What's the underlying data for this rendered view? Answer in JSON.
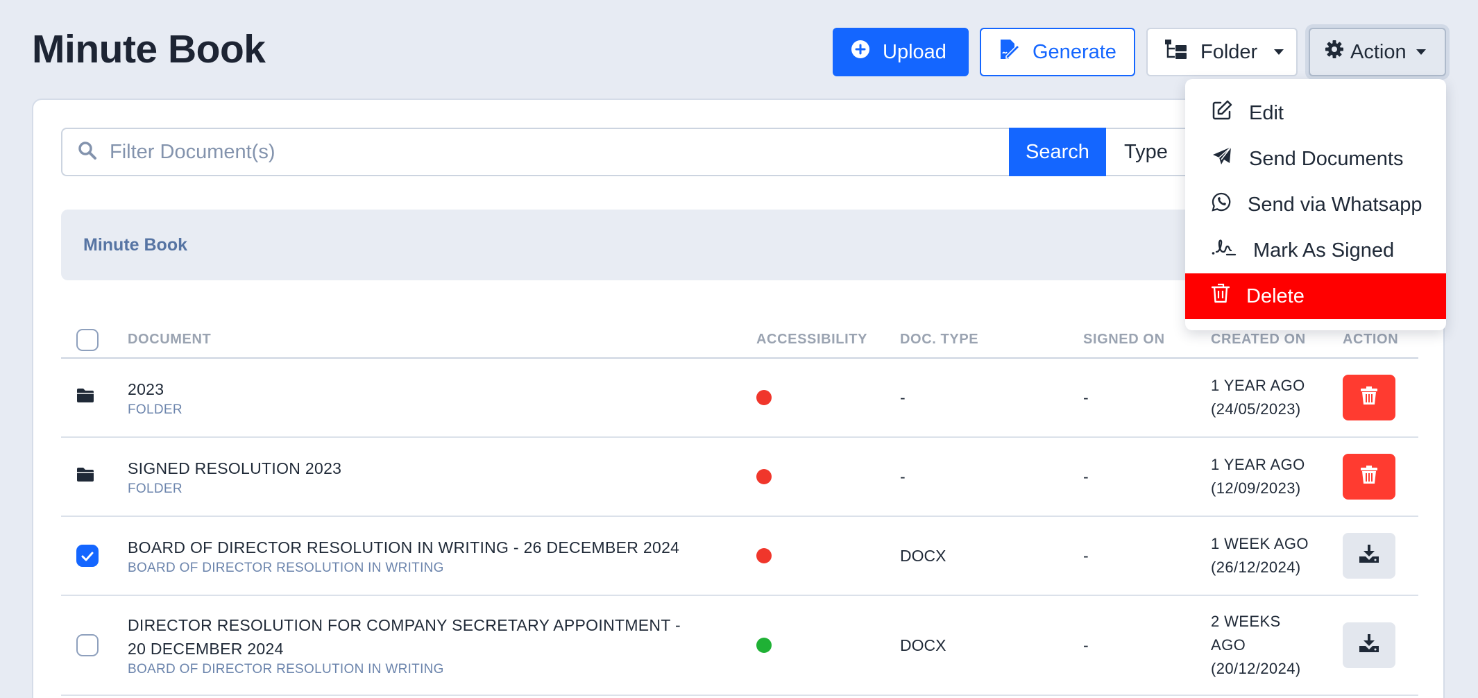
{
  "page": {
    "title": "Minute Book"
  },
  "toolbar": {
    "upload_label": "Upload",
    "generate_label": "Generate",
    "folder_label": "Folder",
    "action_label": "Action"
  },
  "search": {
    "placeholder": "Filter Document(s)",
    "button_label": "Search",
    "type_label": "Type"
  },
  "section": {
    "title": "Minute Book"
  },
  "table": {
    "headers": [
      "DOCUMENT",
      "ACCESSIBILITY",
      "DOC. TYPE",
      "SIGNED ON",
      "CREATED ON",
      "ACTION"
    ],
    "rows": [
      {
        "kind": "folder",
        "name": "2023",
        "sub": "FOLDER",
        "access": "red",
        "doc_type": "-",
        "signed_on": "-",
        "created_rel": "1 YEAR AGO",
        "created_date": "(24/05/2023)",
        "action": "delete"
      },
      {
        "kind": "folder",
        "name": "SIGNED RESOLUTION 2023",
        "sub": "FOLDER",
        "access": "red",
        "doc_type": "-",
        "signed_on": "-",
        "created_rel": "1 YEAR AGO",
        "created_date": "(12/09/2023)",
        "action": "delete"
      },
      {
        "kind": "file",
        "checked": true,
        "name": "BOARD OF DIRECTOR RESOLUTION IN WRITING - 26 DECEMBER 2024",
        "sub": "BOARD OF DIRECTOR RESOLUTION IN WRITING",
        "access": "red",
        "doc_type": "DOCX",
        "signed_on": "-",
        "created_rel": "1 WEEK AGO",
        "created_date": "(26/12/2024)",
        "action": "download"
      },
      {
        "kind": "file",
        "checked": false,
        "name": "DIRECTOR RESOLUTION FOR COMPANY SECRETARY APPOINTMENT - 20 DECEMBER 2024",
        "sub": "BOARD OF DIRECTOR RESOLUTION IN WRITING",
        "access": "green",
        "doc_type": "DOCX",
        "signed_on": "-",
        "created_rel": "2 WEEKS AGO",
        "created_date": "(20/12/2024)",
        "action": "download"
      }
    ]
  },
  "action_menu": {
    "items": [
      {
        "label": "Edit",
        "icon": "edit-icon"
      },
      {
        "label": "Send Documents",
        "icon": "paper-plane-icon"
      },
      {
        "label": "Send via Whatsapp",
        "icon": "whatsapp-icon"
      },
      {
        "label": "Mark As Signed",
        "icon": "signature-icon"
      },
      {
        "label": "Delete",
        "icon": "trash-icon"
      }
    ]
  },
  "colors": {
    "primary": "#1466ff",
    "danger": "#ff3b30",
    "menu_danger": "#ff0000",
    "status_red": "#f0362b",
    "status_green": "#1fb135"
  }
}
